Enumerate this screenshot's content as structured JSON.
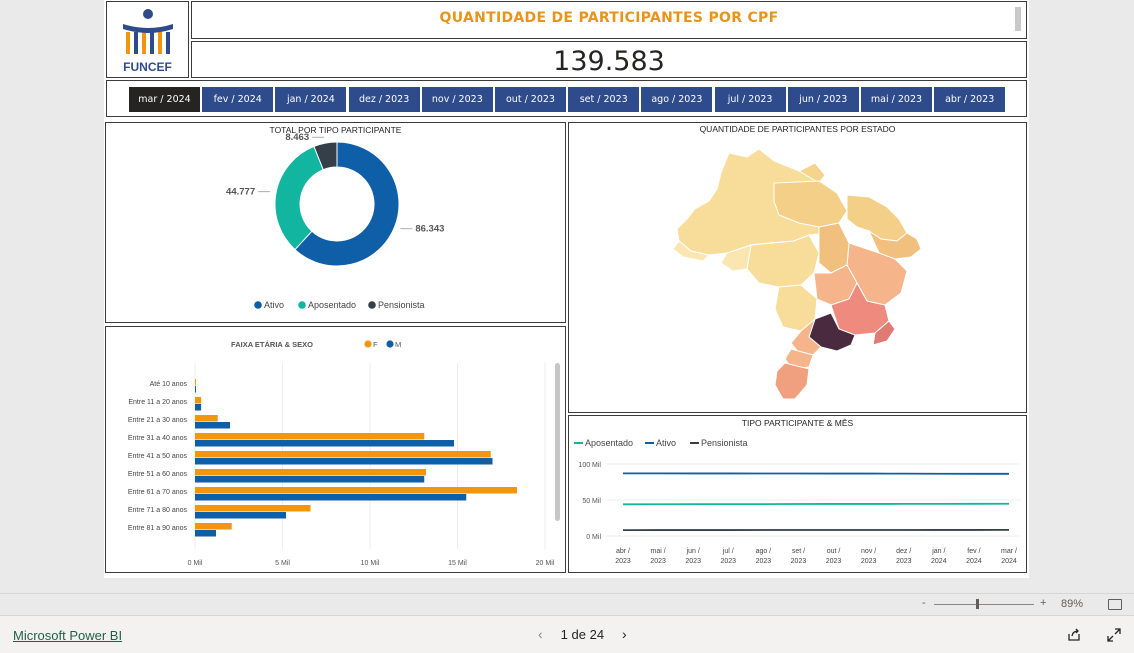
{
  "header": {
    "logo_text": "FUNCEF",
    "title": "QUANTIDADE DE PARTICIPANTES POR CPF",
    "kpi_value": "139.583"
  },
  "slicer": {
    "selected_index": 0,
    "months": [
      "mar / 2024",
      "fev / 2024",
      "jan / 2024",
      "dez / 2023",
      "nov / 2023",
      "out / 2023",
      "set / 2023",
      "ago / 2023",
      "jul / 2023",
      "jun / 2023",
      "mai / 2023",
      "abr / 2023"
    ]
  },
  "colors": {
    "ativo": "#0f5ea8",
    "aposentado": "#11b5a0",
    "pensionista": "#343f4a",
    "female": "#f2960d",
    "male": "#0f5ea8",
    "title_accent": "#e8941b",
    "slicer_bg": "#2e4b8c",
    "slicer_selected": "#252423"
  },
  "chart_data": [
    {
      "type": "donut",
      "title": "TOTAL POR TIPO PARTICIPANTE",
      "slices": [
        {
          "name": "Ativo",
          "value": 86343,
          "label": "86.343"
        },
        {
          "name": "Aposentado",
          "value": 44777,
          "label": "44.777"
        },
        {
          "name": "Pensionista",
          "value": 8463,
          "label": "8.463"
        }
      ],
      "legend": "bottom"
    },
    {
      "type": "bar",
      "orientation": "horizontal",
      "title": "FAIXA ETÁRIA & SEXO",
      "legend": "top",
      "categories": [
        "Até 10 anos",
        "Entre 11 a 20 anos",
        "Entre 21 a 30 anos",
        "Entre 31 a 40 anos",
        "Entre 41 a 50 anos",
        "Entre 51 a 60 anos",
        "Entre 61 a 70 anos",
        "Entre 71 a 80 anos",
        "Entre 81 a 90 anos"
      ],
      "series": [
        {
          "name": "F",
          "values": [
            50,
            350,
            1300,
            13100,
            16900,
            13200,
            18400,
            6600,
            2100
          ]
        },
        {
          "name": "M",
          "values": [
            50,
            350,
            2000,
            14800,
            17000,
            13100,
            15500,
            5200,
            1200
          ]
        }
      ],
      "xlim": [
        0,
        20000
      ],
      "xticks": [
        0,
        5000,
        10000,
        15000,
        20000
      ],
      "xtick_labels": [
        "0 Mil",
        "5 Mil",
        "10 Mil",
        "15 Mil",
        "20 Mil"
      ],
      "grid": true
    },
    {
      "type": "map",
      "title": "QUANTIDADE DE PARTICIPANTES POR ESTADO"
    },
    {
      "type": "line",
      "title": "TIPO PARTICIPANTE & MÊS",
      "legend": "top-left",
      "x": [
        "abr / 2023",
        "mai / 2023",
        "jun / 2023",
        "jul / 2023",
        "ago / 2023",
        "set / 2023",
        "out / 2023",
        "nov / 2023",
        "dez / 2023",
        "jan / 2024",
        "fev / 2024",
        "mar / 2024"
      ],
      "series": [
        {
          "name": "Aposentado",
          "values": [
            44000,
            44100,
            44200,
            44300,
            44300,
            44400,
            44500,
            44500,
            44600,
            44600,
            44700,
            44777
          ]
        },
        {
          "name": "Ativo",
          "values": [
            87000,
            87000,
            86900,
            86900,
            86800,
            86800,
            86700,
            86700,
            86600,
            86500,
            86400,
            86343
          ]
        },
        {
          "name": "Pensionista",
          "values": [
            8200,
            8220,
            8250,
            8270,
            8290,
            8310,
            8340,
            8360,
            8380,
            8410,
            8440,
            8463
          ]
        }
      ],
      "ylim": [
        0,
        100000
      ],
      "yticks": [
        0,
        50000,
        100000
      ],
      "ytick_labels": [
        "0 Mil",
        "50 Mil",
        "100 Mil"
      ],
      "grid": true
    }
  ],
  "footer": {
    "zoom": "89%",
    "zoom_minus": "-",
    "zoom_plus": "+",
    "brand": "Microsoft Power BI",
    "page": "1 de 24",
    "prev": "‹",
    "next": "›"
  }
}
